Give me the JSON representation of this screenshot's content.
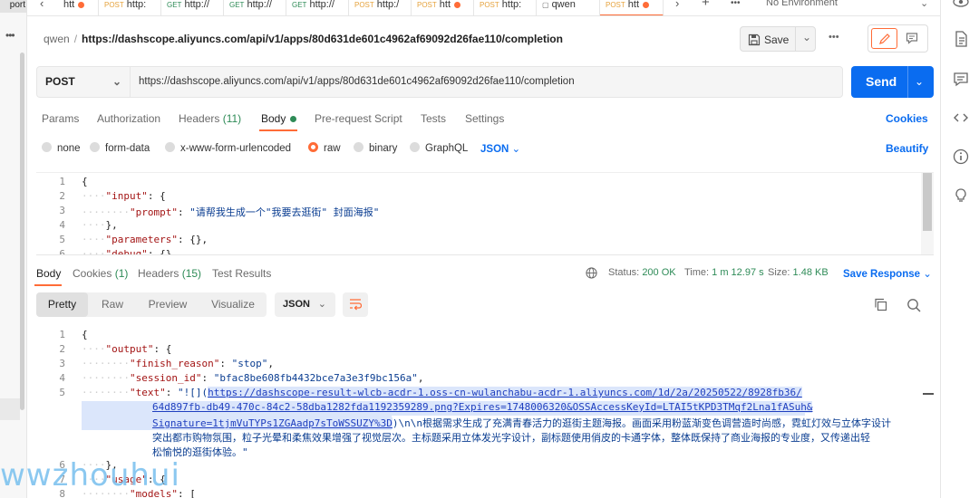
{
  "left_strip": {
    "import_label": "port"
  },
  "tabs": [
    {
      "method": "",
      "title": "htt",
      "dot": true
    },
    {
      "method": "POST",
      "title": "http:",
      "dot": false
    },
    {
      "method": "GET",
      "title": "http://",
      "dot": false
    },
    {
      "method": "GET",
      "title": "http://",
      "dot": false
    },
    {
      "method": "GET",
      "title": "http://",
      "dot": false
    },
    {
      "method": "POST",
      "title": "http:/",
      "dot": false
    },
    {
      "method": "POST",
      "title": "htt",
      "dot": true
    },
    {
      "method": "POST",
      "title": "http:",
      "dot": false
    },
    {
      "method": "",
      "title": "qwen",
      "dot": false
    },
    {
      "method": "POST",
      "title": "htt",
      "dot": true
    }
  ],
  "environment": {
    "label": "No Environment"
  },
  "breadcrumb": {
    "workspace": "qwen",
    "separator": "/",
    "name": "https://dashscope.aliyuncs.com/api/v1/apps/80d631de601c4962af69092d26fae110/completion"
  },
  "toolbar": {
    "save_label": "Save"
  },
  "request": {
    "method": "POST",
    "url": "https://dashscope.aliyuncs.com/api/v1/apps/80d631de601c4962af69092d26fae110/completion",
    "send_label": "Send"
  },
  "request_tabs": {
    "params": "Params",
    "authorization": "Authorization",
    "headers": "Headers",
    "headers_count": "(11)",
    "body": "Body",
    "prerequest": "Pre-request Script",
    "tests": "Tests",
    "settings": "Settings",
    "cookies": "Cookies"
  },
  "body_types": {
    "none": "none",
    "form_data": "form-data",
    "urlencoded": "x-www-form-urlencoded",
    "raw": "raw",
    "binary": "binary",
    "graphql": "GraphQL",
    "format": "JSON",
    "beautify": "Beautify"
  },
  "request_body": {
    "line_numbers": [
      "1",
      "2",
      "3",
      "4",
      "5",
      "6"
    ],
    "l1": "{",
    "l2_key": "\"input\"",
    "l2_rest": ": {",
    "l3_key": "\"prompt\"",
    "l3_colon": ": ",
    "l3_val": "\"请帮我生成一个\"我要去逛街\" 封面海报\"",
    "l4": "},",
    "l5_key": "\"parameters\"",
    "l5_rest": ": {},",
    "l6_key": "\"debug\"",
    "l6_rest": ": {}"
  },
  "response_tabs": {
    "body": "Body",
    "cookies": "Cookies",
    "cookies_count": "(1)",
    "headers": "Headers",
    "headers_count": "(15)",
    "test_results": "Test Results"
  },
  "response_meta": {
    "status_label": "Status:",
    "status_value": "200 OK",
    "time_label": "Time:",
    "time_value": "1 m 12.97 s",
    "size_label": "Size:",
    "size_value": "1.48 KB",
    "save_response": "Save Response"
  },
  "view_modes": {
    "pretty": "Pretty",
    "raw": "Raw",
    "preview": "Preview",
    "visualize": "Visualize",
    "format": "JSON"
  },
  "response_body": {
    "line_numbers": [
      "1",
      "2",
      "3",
      "4",
      "5",
      "",
      "",
      "",
      "",
      "6",
      "7",
      "8"
    ],
    "l1": "{",
    "l2_key": "\"output\"",
    "l2_rest": ": {",
    "l3_key": "\"finish_reason\"",
    "l3_colon": ": ",
    "l3_val": "\"stop\"",
    "l3_comma": ",",
    "l4_key": "\"session_id\"",
    "l4_colon": ": ",
    "l4_val": "\"bfac8be608fb4432bce7a3e3f9bc156a\"",
    "l4_comma": ",",
    "l5_key": "\"text\"",
    "l5_colon": ": ",
    "l5_pre": "\"![](",
    "l5_link1": "https://dashscope-result-wlcb-acdr-1.oss-cn-wulanchabu-acdr-1.aliyuncs.com/1d/2a/20250522/8928fb36/",
    "l5_link2": "64d897fb-db49-470c-84c2-58dba1282fda1192359289.png?Expires=1748006320&OSSAccessKeyId=LTAI5tKPD3TMqf2Lna1fASuh&",
    "l5_link3": "Signature=1tjmVuTYPs1ZGAadp7sToWSSUZY%3D",
    "l5_after": ")\\n\\n根据需求生成了充满青春活力的逛街主题海报。画面采用粉蓝渐变色调营造时尚感，霓虹灯效与立体字设计",
    "l5_cont2": "突出都市购物氛围，粒子光晕和柔焦效果增强了视觉层次。主标题采用立体发光字设计，副标题使用俏皮的卡通字体，整体既保持了商业海报的专业度，又传递出轻",
    "l5_cont3": "松愉悦的逛街体验。\"",
    "l6": "},",
    "l7_key": "\"usage\"",
    "l7_rest": ": {",
    "l8_key": "\"models\"",
    "l8_rest": ": ["
  },
  "watermark": {
    "text": "wwzhouhui"
  },
  "colors": {
    "accent": "#ff6c37",
    "send": "#0a6cf0",
    "status_ok": "#2e8b57"
  }
}
